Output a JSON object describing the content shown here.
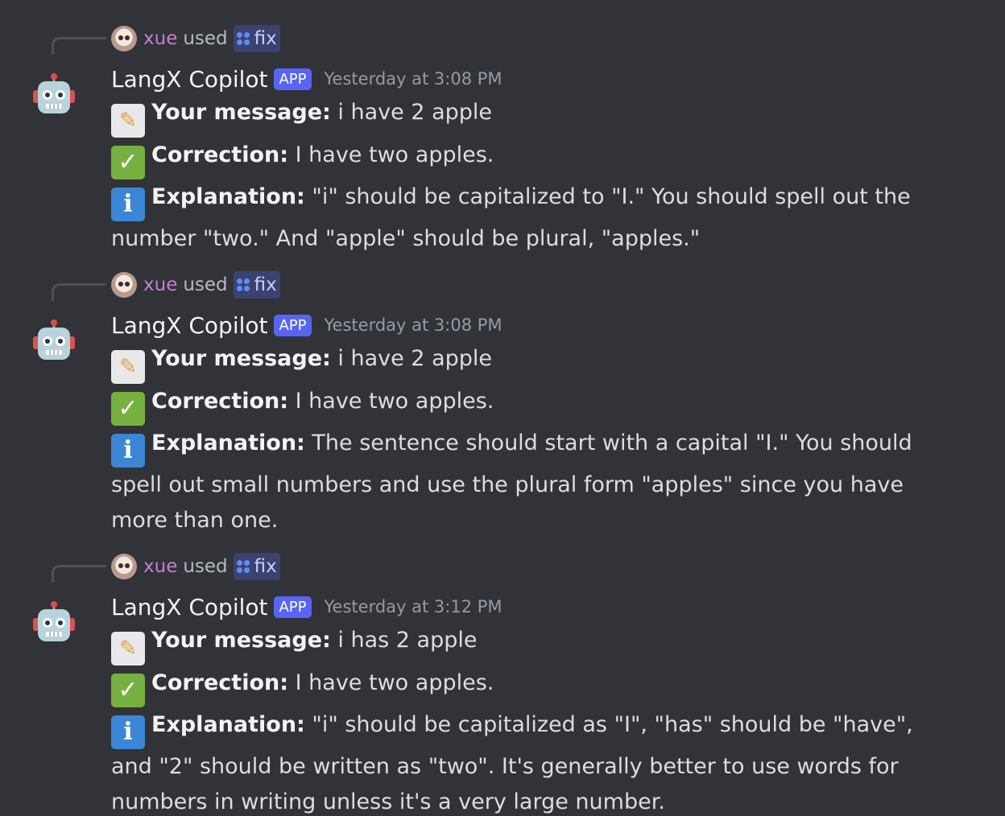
{
  "messages": [
    {
      "reply": {
        "user": "xue",
        "used": "used",
        "command": "fix"
      },
      "author": "LangX Copilot",
      "tag": "APP",
      "timestamp": "Yesterday at 3:08 PM",
      "message_label": "Your message:",
      "message_text": " i have 2 apple",
      "correction_label": "Correction:",
      "correction_text": " I have two apples.",
      "explanation_label": "Explanation:",
      "explanation_text": " \"i\" should be capitalized to \"I.\"  You should spell out the number \"two.\" And \"apple\" should be plural, \"apples.\""
    },
    {
      "reply": {
        "user": "xue",
        "used": "used",
        "command": "fix"
      },
      "author": "LangX Copilot",
      "tag": "APP",
      "timestamp": "Yesterday at 3:08 PM",
      "message_label": "Your message:",
      "message_text": " i have 2 apple",
      "correction_label": "Correction:",
      "correction_text": " I have two apples.",
      "explanation_label": "Explanation:",
      "explanation_text": " The sentence should start with a capital \"I.\" You should spell out small numbers and use the plural form \"apples\" since you have more than one."
    },
    {
      "reply": {
        "user": "xue",
        "used": "used",
        "command": "fix"
      },
      "author": "LangX Copilot",
      "tag": "APP",
      "timestamp": "Yesterday at 3:12 PM",
      "message_label": "Your message:",
      "message_text": " i has 2 apple",
      "correction_label": "Correction:",
      "correction_text": " I have two apples.",
      "explanation_label": "Explanation:",
      "explanation_text": " \"i\" should be capitalized as \"I\", \"has\" should be \"have\", and \"2\" should be written as \"two\". It's generally better to use words for numbers in writing unless it's a very large number."
    }
  ],
  "colors": {
    "background": "#313338",
    "reply_user": "#c77dd8",
    "app_tag": "#5865f2",
    "command_pill": "#3c4270"
  },
  "icons": [
    "robot-icon",
    "memo-icon",
    "check-mark-icon",
    "info-icon",
    "command-icon"
  ]
}
